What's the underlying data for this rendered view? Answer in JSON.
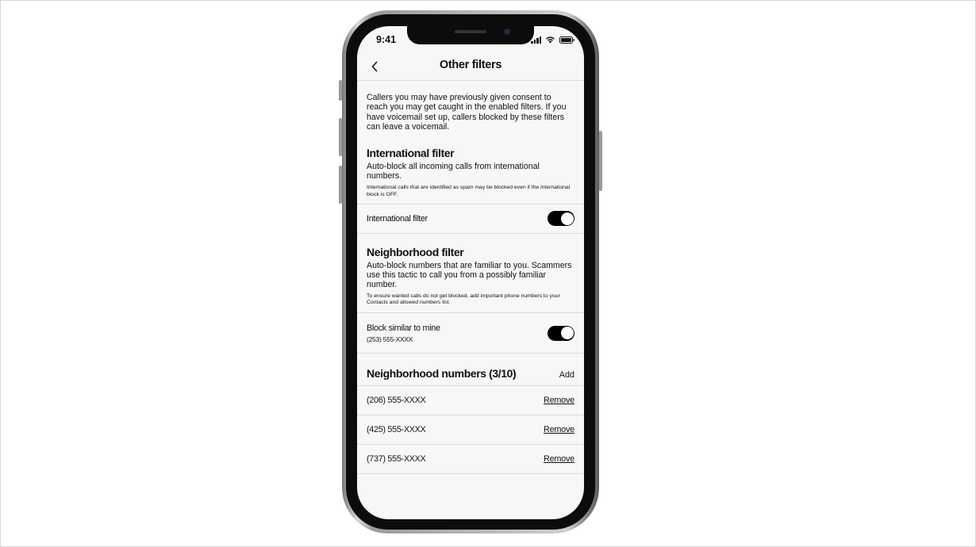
{
  "status_bar": {
    "time": "9:41"
  },
  "header": {
    "title": "Other filters"
  },
  "intro": "Callers you may have previously given consent to reach you may get caught in the enabled filters. If you have voicemail set up, callers blocked by these filters can leave a voicemail.",
  "international": {
    "title": "International filter",
    "description": "Auto-block all incoming calls from international numbers.",
    "note": "International calls that are identified as spam may be blocked even if the international block is OFF.",
    "toggle_label": "International filter",
    "toggle_on": true
  },
  "neighborhood": {
    "title": "Neighborhood filter",
    "description": "Auto-block numbers that are familiar to you. Scammers use this tactic to call you from a possibly familiar number.",
    "note": "To ensure wanted calls do not get blocked, add important phone numbers to your Contacts and allowed numbers list.",
    "toggle_label": "Block similar to mine",
    "toggle_sub": "(253) 555-XXXX",
    "toggle_on": true
  },
  "neighborhood_numbers": {
    "title": "Neighborhood numbers (3/10)",
    "add_label": "Add",
    "items": [
      {
        "number": "(206) 555-XXXX",
        "action": "Remove"
      },
      {
        "number": "(425) 555-XXXX",
        "action": "Remove"
      },
      {
        "number": "(737) 555-XXXX",
        "action": "Remove"
      }
    ]
  },
  "icons": {
    "back": "chevron-left-icon",
    "signal": "cellular-signal-icon",
    "wifi": "wifi-icon",
    "battery": "battery-icon"
  },
  "colors": {
    "toggle_on": "#000000",
    "screen_bg": "#f7f7f7",
    "divider": "#dcdcdc"
  }
}
